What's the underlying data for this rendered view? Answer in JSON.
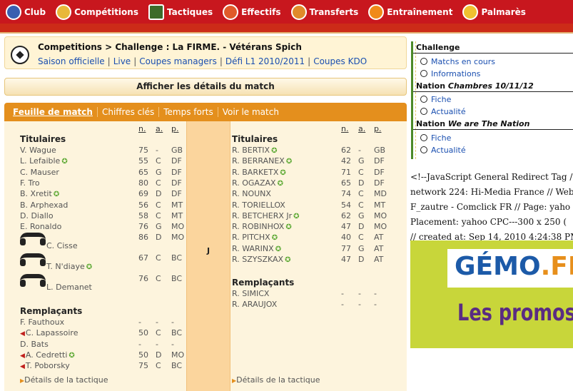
{
  "nav": [
    {
      "label": "Club",
      "icon": "club-crest-icon",
      "color": "#3a5fb0"
    },
    {
      "label": "Compétitions",
      "icon": "trophy-icon",
      "color": "#e8b83a"
    },
    {
      "label": "Tactiques",
      "icon": "tactics-board-icon",
      "color": "#3d6b2a"
    },
    {
      "label": "Effectifs",
      "icon": "player-icon",
      "color": "#e05a2a"
    },
    {
      "label": "Transferts",
      "icon": "transfer-icon",
      "color": "#e08a2a"
    },
    {
      "label": "Entraînement",
      "icon": "training-cone-icon",
      "color": "#f08a1a"
    },
    {
      "label": "Palmarès",
      "icon": "medal-icon",
      "color": "#f0c030"
    }
  ],
  "header": {
    "title": "Competitions > Challenge : La FIRME. - Vétérans Spich",
    "links": [
      "Saison officielle",
      "Live",
      "Coupes managers",
      "Défi L1 2010/2011",
      "Coupes KDO"
    ]
  },
  "details_button": "Afficher les détails du match",
  "tabs": [
    "Feuille de match",
    "Chiffres clés",
    "Temps forts",
    "Voir le match"
  ],
  "columns": {
    "n": "n.",
    "a": "a.",
    "p": "p."
  },
  "home": {
    "starters_title": "Titulaires",
    "starters": [
      {
        "name": "V. Wague",
        "n": "75",
        "a": "-",
        "p": "GB",
        "star": false
      },
      {
        "name": "L. Lefaible",
        "n": "55",
        "a": "C",
        "p": "DF",
        "star": true
      },
      {
        "name": "C. Mauser",
        "n": "65",
        "a": "G",
        "p": "DF",
        "star": false
      },
      {
        "name": "F. Tro",
        "n": "80",
        "a": "C",
        "p": "DF",
        "star": false
      },
      {
        "name": "B. Xretit",
        "n": "69",
        "a": "D",
        "p": "DF",
        "star": true
      },
      {
        "name": "B. Arphexad",
        "n": "56",
        "a": "C",
        "p": "MT",
        "star": false
      },
      {
        "name": "D. Diallo",
        "n": "58",
        "a": "C",
        "p": "MT",
        "star": false
      },
      {
        "name": "E. Ronaldo",
        "n": "76",
        "a": "G",
        "p": "MO",
        "star": false
      },
      {
        "name": "C. Cisse",
        "n": "86",
        "a": "D",
        "p": "MO",
        "star": false
      },
      {
        "name": "T. N'diaye",
        "n": "67",
        "a": "C",
        "p": "BC",
        "star": true
      },
      {
        "name": "L. Demanet",
        "n": "76",
        "a": "C",
        "p": "BC",
        "star": false
      }
    ],
    "subs_title": "Remplaçants",
    "subs": [
      {
        "name": "F. Fauthoux",
        "n": "-",
        "a": "-",
        "p": "-",
        "star": false,
        "arrow": false
      },
      {
        "name": "C. Lapassoire",
        "n": "50",
        "a": "C",
        "p": "BC",
        "star": false,
        "arrow": true
      },
      {
        "name": "D. Bats",
        "n": "-",
        "a": "-",
        "p": "-",
        "star": false,
        "arrow": false
      },
      {
        "name": "A. Cedretti",
        "n": "50",
        "a": "D",
        "p": "MO",
        "star": true,
        "arrow": true
      },
      {
        "name": "T. Poborsky",
        "n": "75",
        "a": "C",
        "p": "BC",
        "star": false,
        "arrow": true
      }
    ],
    "tactique": "Détails de la tactique"
  },
  "away": {
    "starters_title": "Titulaires",
    "starters": [
      {
        "name": "R. BERTIX",
        "n": "62",
        "a": "-",
        "p": "GB",
        "star": true
      },
      {
        "name": "R. BERRANEX",
        "n": "42",
        "a": "G",
        "p": "DF",
        "star": true
      },
      {
        "name": "R. BARKETX",
        "n": "71",
        "a": "C",
        "p": "DF",
        "star": true
      },
      {
        "name": "R. OGAZAX",
        "n": "65",
        "a": "D",
        "p": "DF",
        "star": true
      },
      {
        "name": "R. NOUNX",
        "n": "74",
        "a": "C",
        "p": "MD",
        "star": false
      },
      {
        "name": "R. TORIELLOX",
        "n": "54",
        "a": "C",
        "p": "MT",
        "star": false
      },
      {
        "name": "R. BETCHERX Jr",
        "n": "62",
        "a": "G",
        "p": "MO",
        "star": true
      },
      {
        "name": "R. ROBINHOX",
        "n": "47",
        "a": "D",
        "p": "MO",
        "star": true
      },
      {
        "name": "R. PITCHX",
        "n": "40",
        "a": "C",
        "p": "AT",
        "star": true
      },
      {
        "name": "R. WARINX",
        "n": "77",
        "a": "G",
        "p": "AT",
        "star": true
      },
      {
        "name": "R. SZYSZKAX",
        "n": "47",
        "a": "D",
        "p": "AT",
        "star": true
      }
    ],
    "subs_title": "Remplaçants",
    "subs": [
      {
        "name": "R. SIMICX",
        "n": "-",
        "a": "-",
        "p": "-"
      },
      {
        "name": "R. ARAUJOX",
        "n": "-",
        "a": "-",
        "p": "-"
      }
    ],
    "tactique": "Détails de la tactique"
  },
  "score_label": "J",
  "sidebar": {
    "sections": [
      {
        "title": "Challenge",
        "title_em": "",
        "links": [
          "Matchs en cours",
          "Informations"
        ]
      },
      {
        "title": "Nation ",
        "title_em": "Chambres 10/11/12",
        "links": [
          "Fiche",
          "Actualité"
        ]
      },
      {
        "title": "Nation ",
        "title_em": "We are The Nation",
        "links": [
          "Fiche",
          "Actualité"
        ]
      }
    ]
  },
  "ad_text": [
    "<!--JavaScript General Redirect Tag /",
    "network 224: Hi-Media France // Web",
    "F_zautre - Comclick FR // Page: yaho",
    "Placement: yahoo CPC---300 x 250 (",
    "// created at: Sep 14, 2010 4:24:38 PM"
  ],
  "ad_banner": {
    "brand": "GÉMO",
    "brand_suffix": ".FR",
    "promo": "Les promos"
  }
}
